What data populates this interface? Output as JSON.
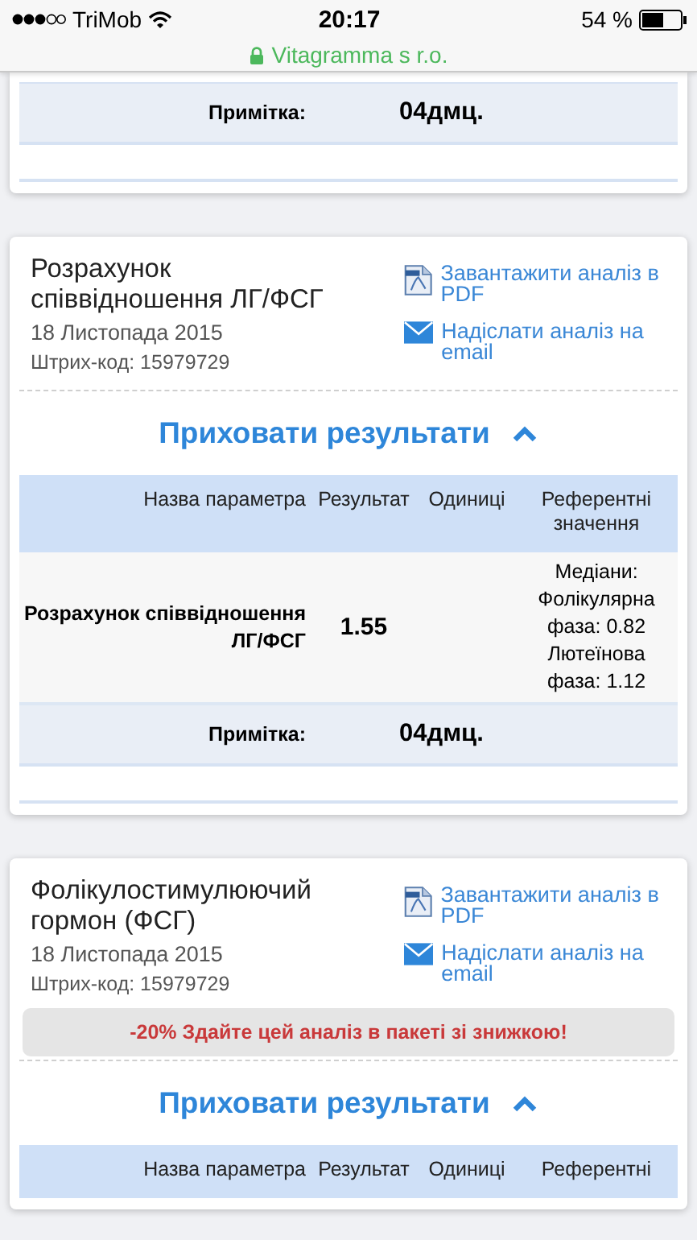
{
  "status_bar": {
    "carrier": "TriMob",
    "time": "20:17",
    "battery": "54 %"
  },
  "address_bar": {
    "site": "Vitagramma s r.o."
  },
  "cards": [
    {
      "kind": "note_only",
      "table": {
        "note": {
          "label": "Примітка:",
          "value": "04дмц."
        }
      }
    },
    {
      "kind": "full",
      "title": "Розрахунок співвідношення ЛГ/ФСГ",
      "date": "18 Листопада 2015",
      "barcode": "Штрих-код: 15979729",
      "pdf_link": "Завантажити аналіз в PDF",
      "email_link": "Надіслати аналіз на email",
      "toggle": "Приховати результати",
      "table": {
        "columns": [
          "Назва параметра",
          "Результат",
          "Одиниці",
          "Референтні значення"
        ],
        "rows": [
          {
            "name": "Розрахунок співвідношення ЛГ/ФСГ",
            "result": "1.55",
            "reference": "Медіани: Фолікулярна фаза: 0.82 Лютеїнова фаза: 1.12"
          }
        ],
        "note": {
          "label": "Примітка:",
          "value": "04дмц."
        }
      }
    },
    {
      "kind": "full",
      "title": "Фолікулостимулюючий гормон (ФСГ)",
      "date": "18 Листопада 2015",
      "barcode": "Штрих-код: 15979729",
      "pdf_link": "Завантажити аналіз в PDF",
      "email_link": "Надіслати аналіз на email",
      "promo": "-20% Здайте цей аналіз в пакеті зі знижкою!",
      "toggle": "Приховати результати",
      "table": {
        "columns": [
          "Назва параметра",
          "Результат",
          "Одиниці",
          "Референтні"
        ]
      }
    }
  ]
}
